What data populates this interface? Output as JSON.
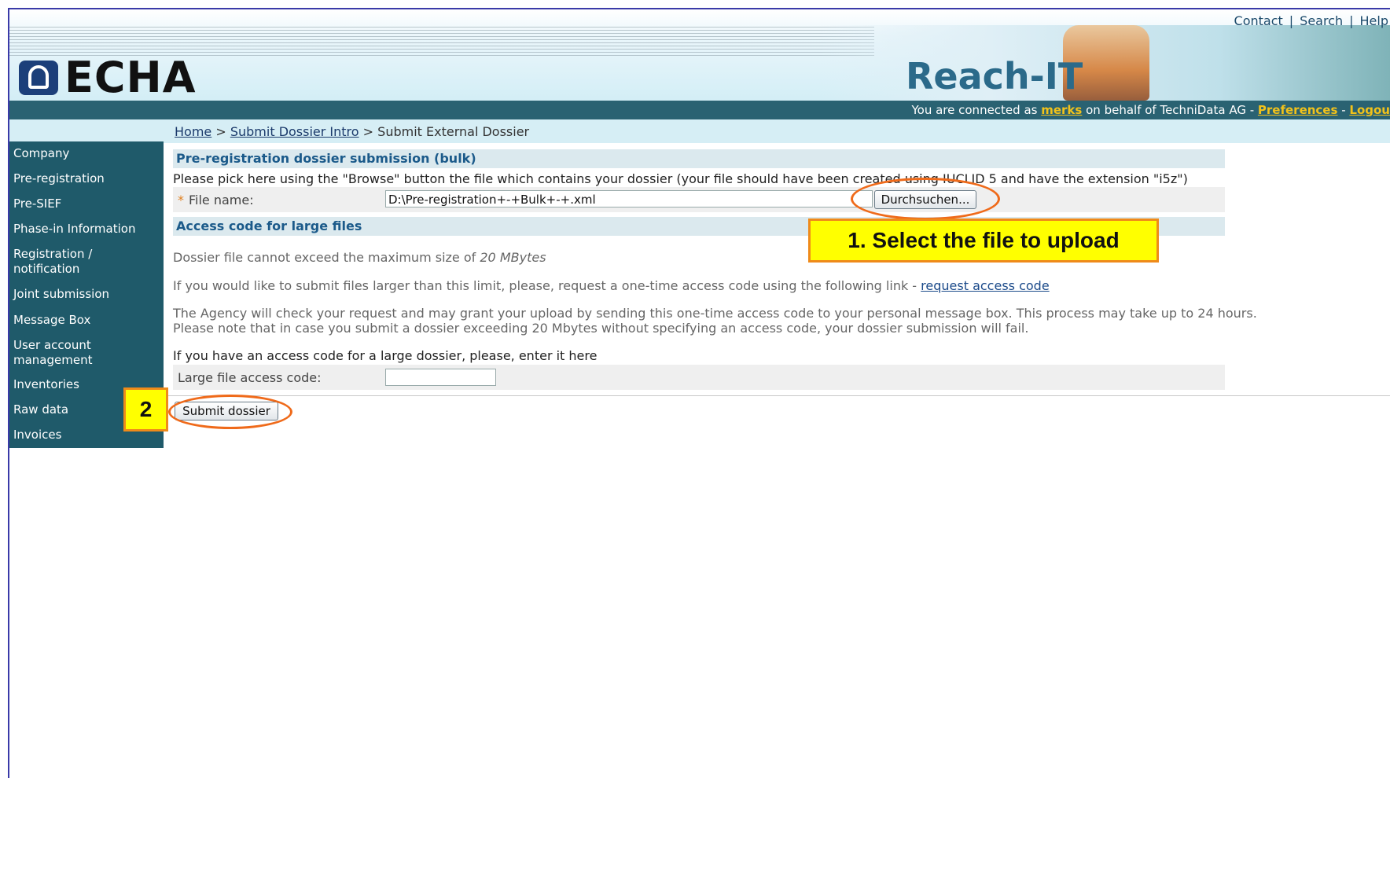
{
  "header": {
    "top_links": [
      "Contact",
      "Search",
      "Help"
    ],
    "logo_text": "ECHA",
    "app_title": "Reach-IT"
  },
  "connection": {
    "prefix": "You are connected as",
    "user": "merks",
    "middle": "on behalf of TechniData AG -",
    "preferences": "Preferences",
    "dash": "-",
    "logout": "Logou"
  },
  "breadcrumb": {
    "home": "Home",
    "sep": ">",
    "intro": "Submit Dossier Intro",
    "current": "Submit External Dossier"
  },
  "sidebar": {
    "items": [
      {
        "label": "Company"
      },
      {
        "label": "Pre-registration"
      },
      {
        "label": "Pre-SIEF"
      },
      {
        "label": "Phase-in Information"
      },
      {
        "label": "Registration / notification"
      },
      {
        "label": "Joint submission"
      },
      {
        "label": "Message Box"
      },
      {
        "label": "User account management"
      },
      {
        "label": "Inventories"
      },
      {
        "label": "Raw data"
      },
      {
        "label": "Invoices"
      }
    ]
  },
  "main": {
    "section1_title": "Pre-registration dossier submission (bulk)",
    "instructions": "Please pick here using the \"Browse\" button the file which contains your dossier (your file should have been created using IUCLID 5 and have the extension \"i5z\")",
    "file_label": "File name:",
    "file_value": "D:\\Pre-registration+-+Bulk+-+.xml",
    "browse_label": "Durchsuchen...",
    "section2_title": "Access code for large files",
    "max_size_text": "Dossier file cannot exceed the maximum size of",
    "max_size_value": "20 MBytes",
    "larger_text": "If you would like to submit files larger than this limit, please, request a one-time access code using the following link -",
    "request_link": "request access code",
    "agency_line1": "The Agency will check your request and may grant your upload by sending this one-time access code to your personal message box. This process may take up to 24 hours.",
    "agency_line2": "Please note that in case you submit a dossier exceeding 20 Mbytes without specifying an access code, your dossier submission will fail.",
    "enter_code_text": "If you have an access code for a large dossier, please, enter it here",
    "access_code_label": "Large file access code:",
    "access_code_value": "",
    "submit_label": "Submit dossier"
  },
  "annotations": {
    "callout1": "1. Select the file to upload",
    "callout2": "2",
    "highlight_color": "#ef6a1a",
    "callout_bg": "#ffff00"
  }
}
